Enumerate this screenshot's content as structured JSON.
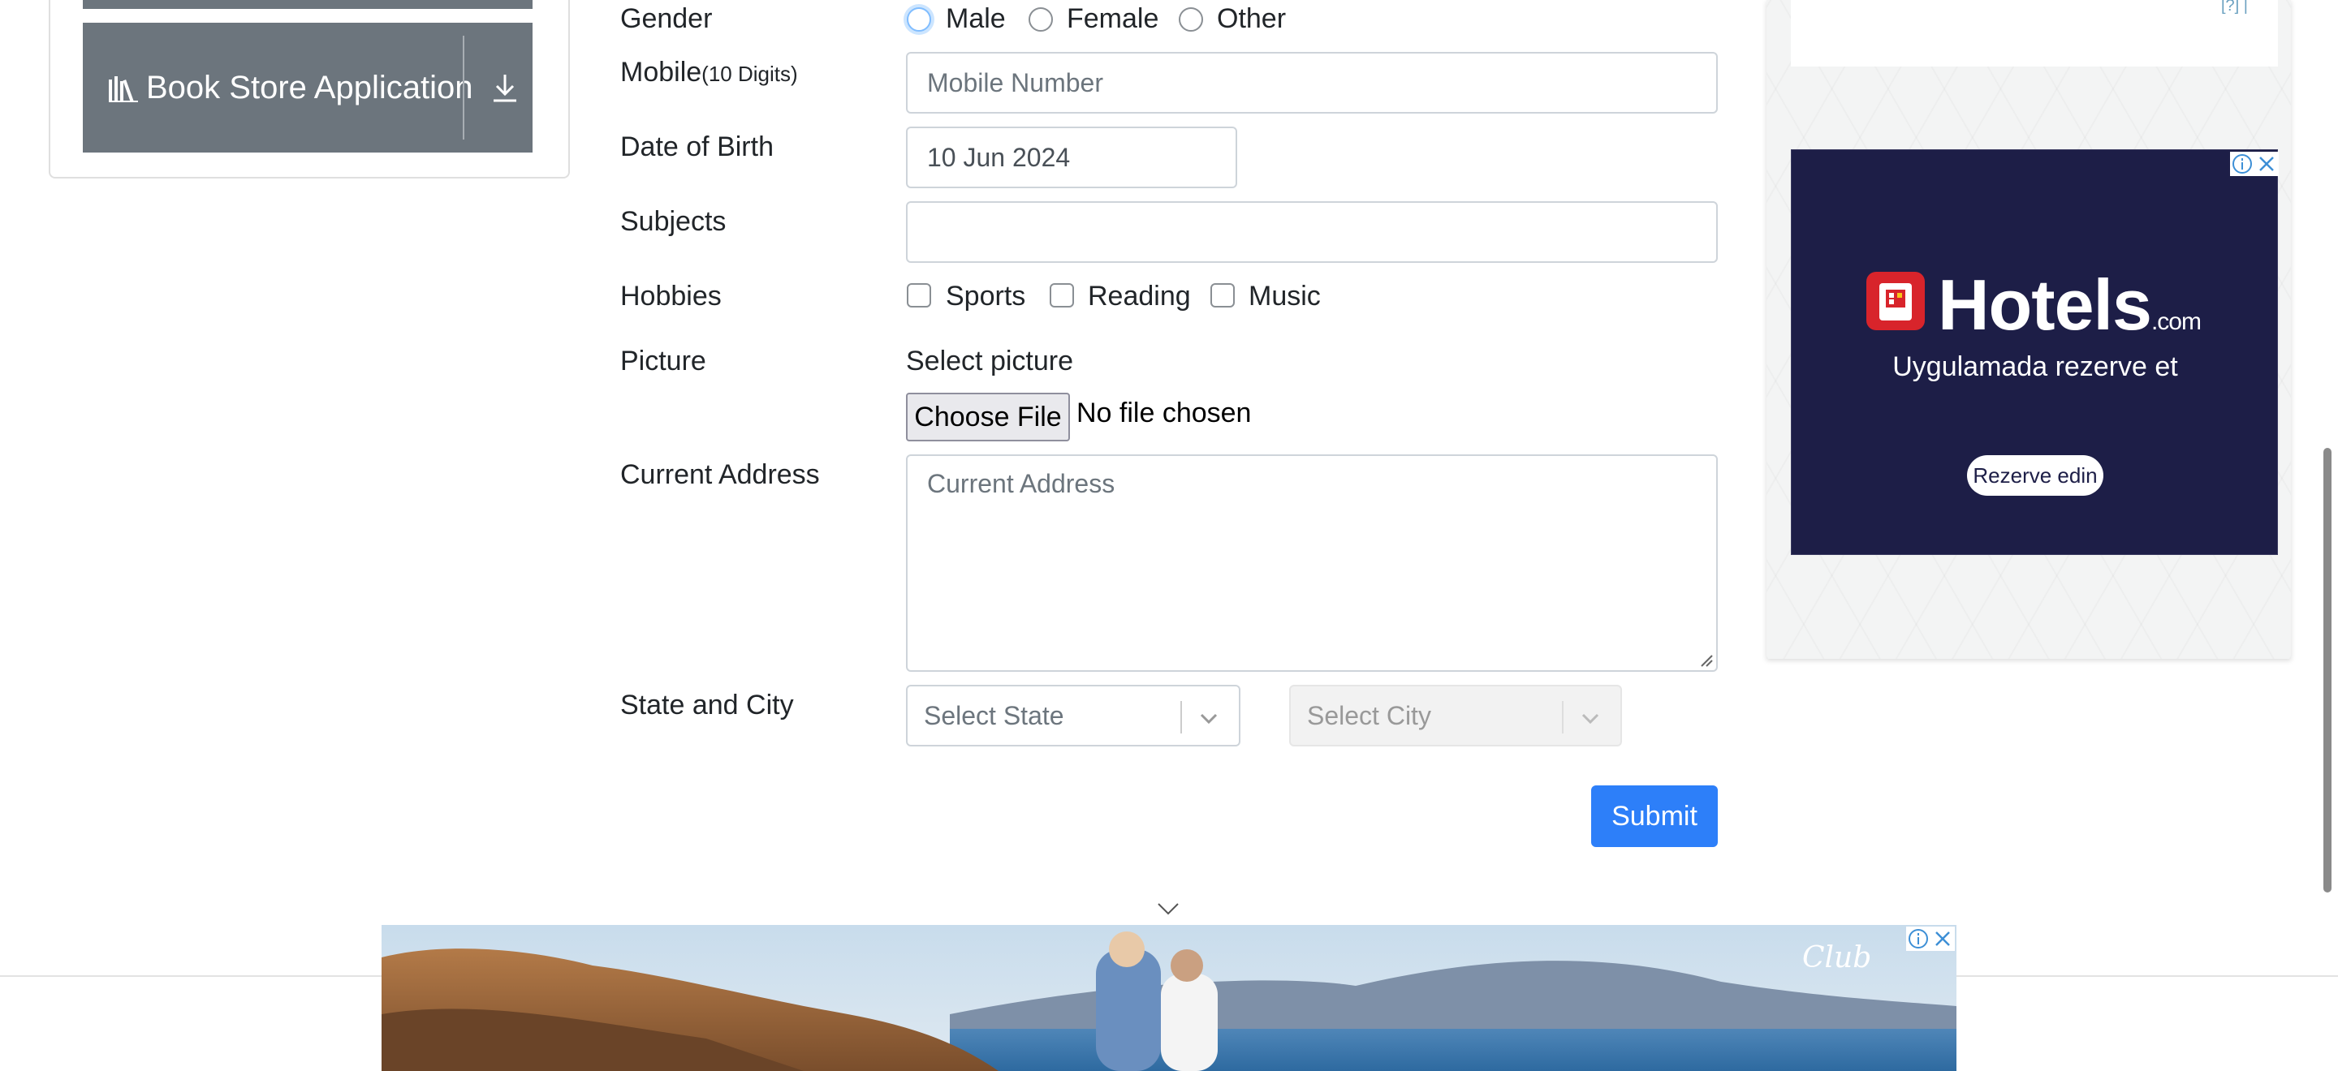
{
  "sidebar": {
    "book_store_label": "Book Store Application"
  },
  "form": {
    "gender": {
      "label": "Gender",
      "options": [
        "Male",
        "Female",
        "Other"
      ]
    },
    "mobile": {
      "label": "Mobile",
      "hint": "(10 Digits)",
      "placeholder": "Mobile Number"
    },
    "dob": {
      "label": "Date of Birth",
      "value": "10 Jun 2024"
    },
    "subjects": {
      "label": "Subjects",
      "value": ""
    },
    "hobbies": {
      "label": "Hobbies",
      "options": [
        "Sports",
        "Reading",
        "Music"
      ]
    },
    "picture": {
      "label": "Picture",
      "select_label": "Select picture",
      "button": "Choose File",
      "status": "No file chosen"
    },
    "address": {
      "label": "Current Address",
      "placeholder": "Current Address"
    },
    "state_city": {
      "label": "State and City",
      "state_placeholder": "Select State",
      "city_placeholder": "Select City"
    },
    "submit": "Submit"
  },
  "ads": {
    "top_marks": "[?] |",
    "hotels": {
      "brand": "Hotels",
      "dotcom": ".com",
      "tagline": "Uygulamada rezerve et",
      "cta": "Rezerve edin"
    },
    "bottom": {
      "brand": "Club"
    }
  },
  "colors": {
    "button_gray": "#6c757d",
    "submit_blue": "#2d7ff9",
    "hotels_navy": "#1d1e47",
    "hotels_red": "#d8242b"
  }
}
